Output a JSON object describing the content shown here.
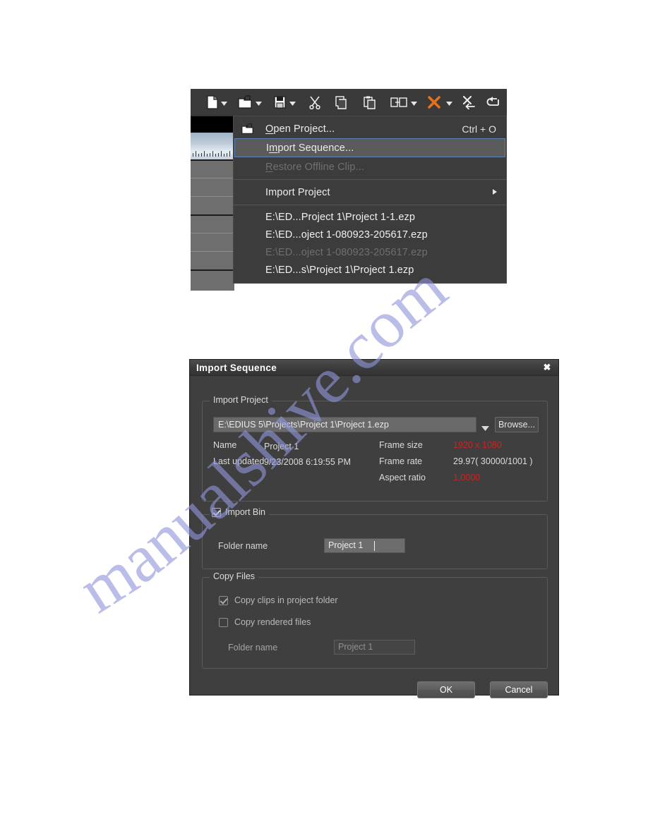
{
  "toolbar": {
    "icons": [
      {
        "name": "new-project-icon",
        "caret": true
      },
      {
        "name": "open-project-icon",
        "caret": true
      },
      {
        "name": "save-project-icon",
        "caret": true
      },
      {
        "name": "cut-icon",
        "caret": false
      },
      {
        "name": "copy-icon",
        "caret": false
      },
      {
        "name": "paste-icon",
        "caret": false
      },
      {
        "name": "replace-clip-icon",
        "caret": true
      },
      {
        "name": "delete-icon",
        "caret": true
      },
      {
        "name": "ripple-delete-icon",
        "caret": false
      },
      {
        "name": "undo-icon",
        "caret": false
      }
    ],
    "delete_icon_color": "#e8701a"
  },
  "menu": {
    "items": [
      {
        "label": "Open Project...",
        "accel": "Ctrl + O",
        "icon": "open-project-icon",
        "state": "normal",
        "mnemonic": "O",
        "submenu": false
      },
      {
        "label": "Import Sequence...",
        "accel": "",
        "icon": "",
        "state": "highlight",
        "mnemonic": "m",
        "submenu": false
      },
      {
        "label": "Restore Offline Clip...",
        "accel": "",
        "icon": "",
        "state": "disabled",
        "mnemonic": "R",
        "submenu": false
      },
      {
        "label": "Import Project",
        "accel": "",
        "icon": "",
        "state": "normal",
        "mnemonic": "",
        "submenu": true
      }
    ],
    "recent": [
      {
        "label": "E:\\ED...Project 1\\Project 1-1.ezp",
        "state": "normal"
      },
      {
        "label": "E:\\ED...oject 1-080923-205617.ezp",
        "state": "normal"
      },
      {
        "label": "E:\\ED...oject 1-080923-205617.ezp",
        "state": "disabled"
      },
      {
        "label": "E:\\ED...s\\Project 1\\Project 1.ezp",
        "state": "normal"
      }
    ],
    "highlight_border_color": "#5d82b4"
  },
  "dialog": {
    "title": "Import Sequence",
    "close_label": "✖",
    "import_project": {
      "legend": "Import Project",
      "path_value": "E:\\EDIUS 5\\Projects\\Project 1\\Project 1.ezp",
      "browse_label": "Browse...",
      "fields": {
        "name_label": "Name",
        "name_value": "Project 1",
        "updated_label": "Last updated",
        "updated_value": "9/23/2008 6:19:55 PM",
        "frame_size_label": "Frame size",
        "frame_size_value": "1920 x 1080",
        "frame_rate_label": "Frame rate",
        "frame_rate_value": "29.97( 30000/1001 )",
        "aspect_ratio_label": "Aspect ratio",
        "aspect_ratio_value": "1.0000"
      },
      "highlight_color": "#cc2222"
    },
    "import_bin": {
      "legend": "Import Bin",
      "checked": true,
      "folder_name_label": "Folder name",
      "folder_name_value": "Project 1"
    },
    "copy_files": {
      "legend": "Copy Files",
      "copy_clips_label": "Copy clips in project folder",
      "copy_clips_checked": true,
      "copy_rendered_label": "Copy rendered files",
      "copy_rendered_checked": false,
      "folder_name_label": "Folder name",
      "folder_name_value": "Project 1"
    },
    "buttons": {
      "ok_label": "OK",
      "cancel_label": "Cancel"
    }
  },
  "watermark": {
    "text": "manualshive.com",
    "color": "#8b8fd4"
  }
}
